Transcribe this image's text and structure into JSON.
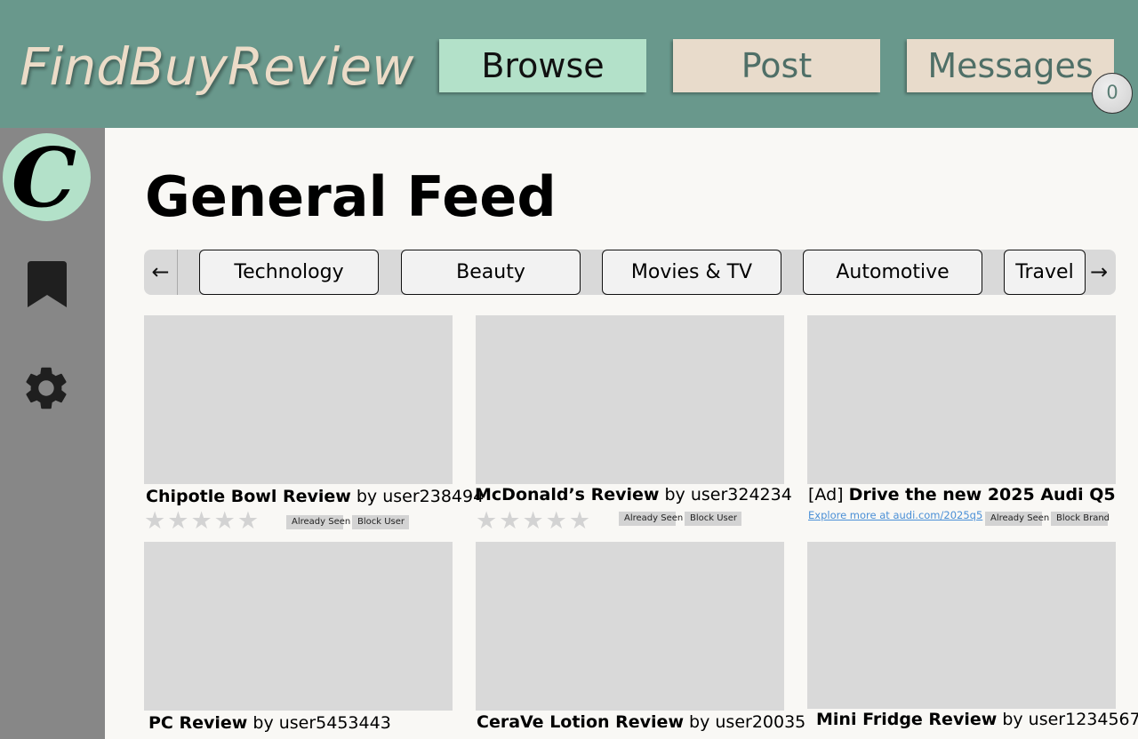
{
  "header": {
    "logo": "FindBuyReview",
    "nav": {
      "browse": "Browse",
      "post": "Post",
      "messages": "Messages"
    },
    "message_count": "0"
  },
  "sidebar": {
    "avatar_initial": "C",
    "icons": [
      "bookmark-icon",
      "gear-icon"
    ]
  },
  "main": {
    "title": "General Feed",
    "categories": [
      "Technology",
      "Beauty",
      "Movies & TV",
      "Automotive",
      "Travel"
    ],
    "cards": [
      {
        "title": "Chipotle Bowl Review",
        "byline": " by user238494",
        "rating": 0,
        "btn1": "Already Seen",
        "btn2": "Block User"
      },
      {
        "title": "McDonald’s Review",
        "byline": " by user324234",
        "rating": 0,
        "btn1": "Already Seen",
        "btn2": "Block User"
      },
      {
        "prefix": "[Ad] ",
        "title": "Drive the new 2025 Audi Q5",
        "link": "Explore more at audi.com/2025q5",
        "btn1": "Already Seen",
        "btn2": "Block Brand"
      },
      {
        "title": "PC Review",
        "byline": " by user5453443"
      },
      {
        "title": "CeraVe Lotion Review",
        "byline": " by user20035"
      },
      {
        "title": "Mini Fridge Review",
        "byline": " by user1234567"
      }
    ]
  },
  "colors": {
    "header_bg": "#69988c",
    "browse_active": "#b3e1c9",
    "nav_inactive": "#e8dbcb",
    "sidebar_bg": "#878787",
    "logo_text": "#ecdcc8"
  }
}
